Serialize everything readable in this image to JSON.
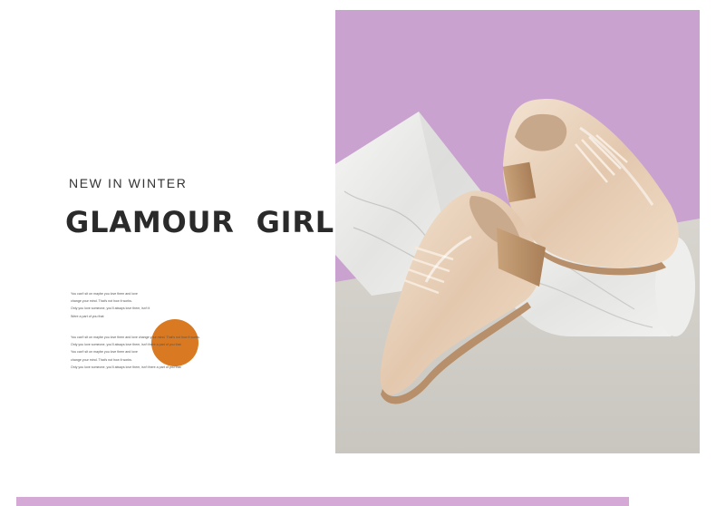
{
  "header": {
    "subtitle": "NEW IN WINTER",
    "title": "GLAMOUR  GIRL"
  },
  "copy": {
    "block1": [
      "You can't sit on maybe you love them and love",
      "change your mind. That's not how it works.",
      "Only you love someone, you'll always love them, isn't it",
      "Were a part of you that"
    ],
    "block2": [
      "You can't sit on maybe you love them and love change your mind. That's not how it works.",
      "Only you love someone, you'll always love them, isn't there a part of you that",
      "You can't sit on maybe you love them and love",
      "change your mind. That's not how it works.",
      "Only you love someone, you'll always love them, isn't there a part of you that"
    ]
  },
  "colors": {
    "accent_orange": "#d97a22",
    "backdrop_purple": "#c9a2cf",
    "floor_grey": "#cfccc6",
    "shoe_nude": "#e9d3be",
    "bottom_bar": "#d4a9d6"
  },
  "photo": {
    "subject": "nude patent leather lace-up oxford shoes on marble blocks"
  }
}
